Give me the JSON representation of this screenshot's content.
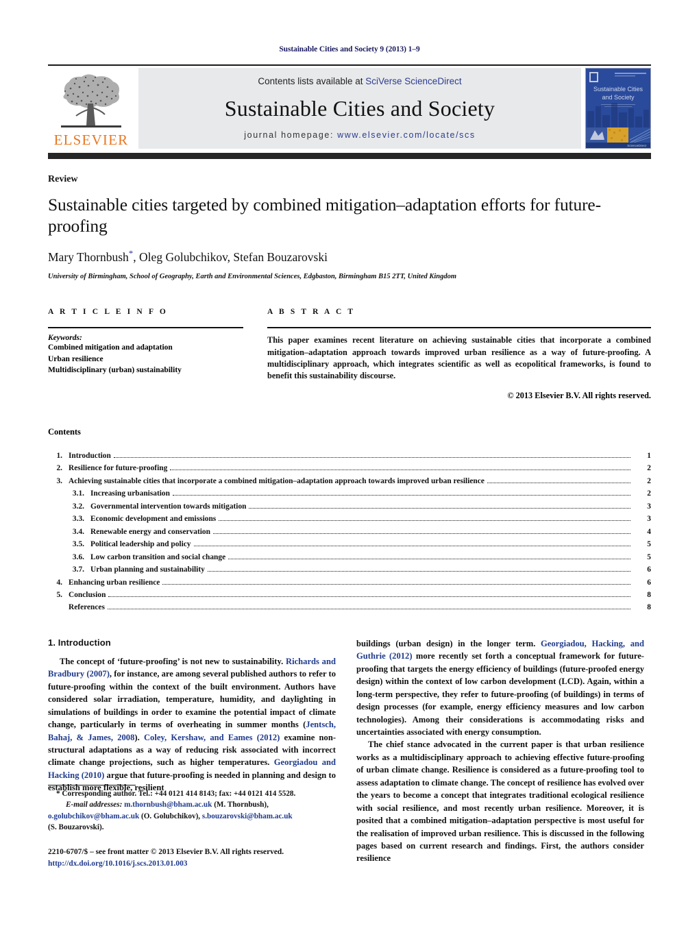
{
  "running_head": "Sustainable Cities and Society 9 (2013) 1–9",
  "journal_header": {
    "contents_prefix": "Contents lists available at ",
    "sciencedirect_link": "SciVerse ScienceDirect",
    "journal_title": "Sustainable Cities and Society",
    "homepage_prefix": "journal homepage: ",
    "homepage_url": "www.elsevier.com/locate/scs",
    "publisher_logo_text": "ELSEVIER",
    "cover_title_line1": "Sustainable Cities",
    "cover_title_line2": "and Society",
    "accent_orange": "#E87722",
    "link_blue": "#2c3d8f",
    "band_gray": "#e8e9eb"
  },
  "article": {
    "doctype": "Review",
    "title": "Sustainable cities targeted by combined mitigation–adaptation efforts for future-proofing",
    "authors": "Mary Thornbush",
    "authors_rest": ", Oleg Golubchikov, Stefan Bouzarovski",
    "corresponding_marker": "*",
    "affiliation": "University of Birmingham, School of Geography, Earth and Environmental Sciences, Edgbaston, Birmingham B15 2TT, United Kingdom"
  },
  "article_info": {
    "heading": "A R T I C L E   I N F O",
    "keywords_label": "Keywords:",
    "keywords": [
      "Combined mitigation and adaptation",
      "Urban resilience",
      "Multidisciplinary (urban) sustainability"
    ]
  },
  "abstract": {
    "heading": "A B S T R A C T",
    "text": "This paper examines recent literature on achieving sustainable cities that incorporate a combined mitigation–adaptation approach towards improved urban resilience as a way of future-proofing. A multidisciplinary approach, which integrates scientific as well as ecopolitical frameworks, is found to benefit this sustainability discourse.",
    "copyright": "© 2013 Elsevier B.V. All rights reserved."
  },
  "contents": {
    "heading": "Contents",
    "items": [
      {
        "num": "1.",
        "label": "Introduction",
        "page": "1",
        "level": 1
      },
      {
        "num": "2.",
        "label": "Resilience for future-proofing",
        "page": "2",
        "level": 1
      },
      {
        "num": "3.",
        "label": "Achieving sustainable cities that incorporate a combined mitigation–adaptation approach towards improved urban resilience",
        "page": "2",
        "level": 1
      },
      {
        "num": "3.1.",
        "label": "Increasing urbanisation",
        "page": "2",
        "level": 2
      },
      {
        "num": "3.2.",
        "label": "Governmental intervention towards mitigation",
        "page": "3",
        "level": 2
      },
      {
        "num": "3.3.",
        "label": "Economic development and emissions",
        "page": "3",
        "level": 2
      },
      {
        "num": "3.4.",
        "label": "Renewable energy and conservation",
        "page": "4",
        "level": 2
      },
      {
        "num": "3.5.",
        "label": "Political leadership and policy",
        "page": "5",
        "level": 2
      },
      {
        "num": "3.6.",
        "label": "Low carbon transition and social change",
        "page": "5",
        "level": 2
      },
      {
        "num": "3.7.",
        "label": "Urban planning and sustainability",
        "page": "6",
        "level": 2
      },
      {
        "num": "4.",
        "label": "Enhancing urban resilience",
        "page": "6",
        "level": 1
      },
      {
        "num": "5.",
        "label": "Conclusion",
        "page": "8",
        "level": 1
      },
      {
        "num": "",
        "label": "References",
        "page": "8",
        "level": 1
      }
    ]
  },
  "body": {
    "section1_title": "1.  Introduction",
    "left_para1_a": "The concept of ‘future-proofing’ is not new to sustainability. ",
    "left_para1_cite1": "Richards and Bradbury (2007)",
    "left_para1_b": ", for instance, are among several published authors to refer to future-proofing within the context of the built environment. Authors have considered solar irradiation, temperature, humidity, and daylighting in simulations of buildings in order to examine the potential impact of climate change, particularly in terms of overheating in summer months (",
    "left_para1_cite2": "Jentsch, Bahaj, & James, 2008",
    "left_para1_c": "). ",
    "left_para1_cite3": "Coley, Kershaw, and Eames (2012)",
    "left_para1_d": " examine non-structural adaptations as a way of reducing risk associated with incorrect climate change projections, such as higher temperatures. ",
    "left_para1_cite4": "Georgiadou and Hacking (2010)",
    "left_para1_e": " argue that future-proofing is needed in planning and design to establish more flexible, resilient",
    "right_para1_a": "buildings (urban design) in the longer term. ",
    "right_para1_cite1": "Georgiadou, Hacking, and Guthrie (2012)",
    "right_para1_b": " more recently set forth a conceptual framework for future-proofing that targets the energy efficiency of buildings (future-proofed energy design) within the context of low carbon development (LCD). Again, within a long-term perspective, they refer to future-proofing (of buildings) in terms of design processes (for example, energy efficiency measures and low carbon technologies). Among their considerations is accommodating risks and uncertainties associated with energy consumption.",
    "right_para2": "The chief stance advocated in the current paper is that urban resilience works as a multidisciplinary approach to achieving effective future-proofing of urban climate change. Resilience is considered as a future-proofing tool to assess adaptation to climate change. The concept of resilience has evolved over the years to become a concept that integrates traditional ecological resilience with social resilience, and most recently urban resilience. Moreover, it is posited that a combined mitigation–adaptation perspective is most useful for the realisation of improved urban resilience. This is discussed in the following pages based on current research and findings. First, the authors consider resilience"
  },
  "footnote": {
    "corresponding": "* Corresponding author. Tel.: +44 0121 414 8143; fax: +44 0121 414 5528.",
    "email_label": "E-mail addresses:",
    "email1": "m.thornbush@bham.ac.uk",
    "email1_name": " (M. Thornbush),",
    "email2": "o.golubchikov@bham.ac.uk",
    "email2_name": " (O. Golubchikov), ",
    "email3": "s.bouzarovski@bham.ac.uk",
    "email3_name": "(S. Bouzarovski).",
    "issn_line": "2210-6707/$ – see front matter © 2013 Elsevier B.V. All rights reserved.",
    "doi_line": "http://dx.doi.org/10.1016/j.scs.2013.01.003"
  }
}
